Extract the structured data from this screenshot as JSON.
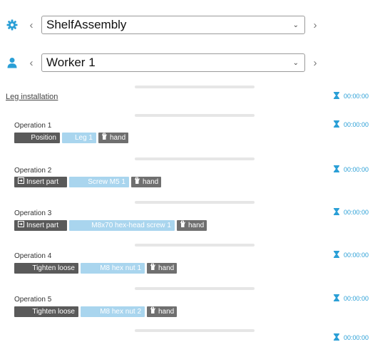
{
  "assembly": {
    "value": "ShelfAssembly"
  },
  "worker": {
    "value": "Worker 1"
  },
  "group": {
    "title": "Leg installation",
    "time": "00:00:00"
  },
  "operations": [
    {
      "title": "Operation 1",
      "action": "Position",
      "action_icon": "",
      "part": "Leg 1",
      "tool": "hand",
      "time": "00:00:00"
    },
    {
      "title": "Operation 2",
      "action": "Insert part",
      "action_icon": "insert-icon",
      "part": "Screw M5 1",
      "tool": "hand",
      "time": "00:00:00"
    },
    {
      "title": "Operation 3",
      "action": "Insert part",
      "action_icon": "insert-icon",
      "part": "M8x70 hex-head screw 1",
      "tool": "hand",
      "time": "00:00:00"
    },
    {
      "title": "Operation 4",
      "action": "Tighten loose",
      "action_icon": "",
      "part": "M8 hex nut 1",
      "tool": "hand",
      "time": "00:00:00"
    },
    {
      "title": "Operation 5",
      "action": "Tighten loose",
      "action_icon": "",
      "part": "M8 hex nut 2",
      "tool": "hand",
      "time": "00:00:00"
    }
  ],
  "next_timer": {
    "time": "00:00:00"
  },
  "colors": {
    "accent": "#2a9fd6",
    "action_tag": "#5a5a5a",
    "part_tag": "#a9d5ee",
    "tool_tag": "#6f6f6f",
    "separator": "#e6e6e6"
  }
}
